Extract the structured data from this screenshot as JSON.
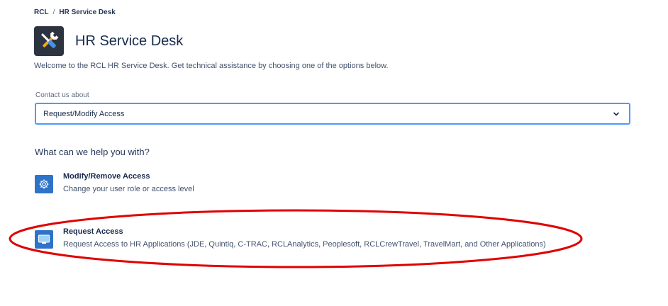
{
  "breadcrumb": {
    "root": "RCL",
    "separator": "/",
    "current": "HR Service Desk"
  },
  "header": {
    "title": "HR Service Desk",
    "logo_icon": "tools-icon"
  },
  "welcome_text": "Welcome to the RCL HR Service Desk. Get technical assistance by choosing one of the options below.",
  "contact": {
    "label": "Contact us about",
    "selected_value": "Request/Modify Access"
  },
  "help_heading": "What can we help you with?",
  "options": [
    {
      "title": "Modify/Remove Access",
      "description": "Change your user role or access level",
      "icon": "gear-icon"
    },
    {
      "title": "Request Access",
      "description": "Request Access to HR Applications (JDE, Quintiq, C-TRAC, RCLAnalytics, Peoplesoft, RCLCrewTravel, TravelMart, and Other Applications)",
      "icon": "monitor-icon"
    }
  ],
  "colors": {
    "accent": "#4c9aff",
    "icon_bg": "#2f73c9",
    "annotation": "#e00000"
  }
}
